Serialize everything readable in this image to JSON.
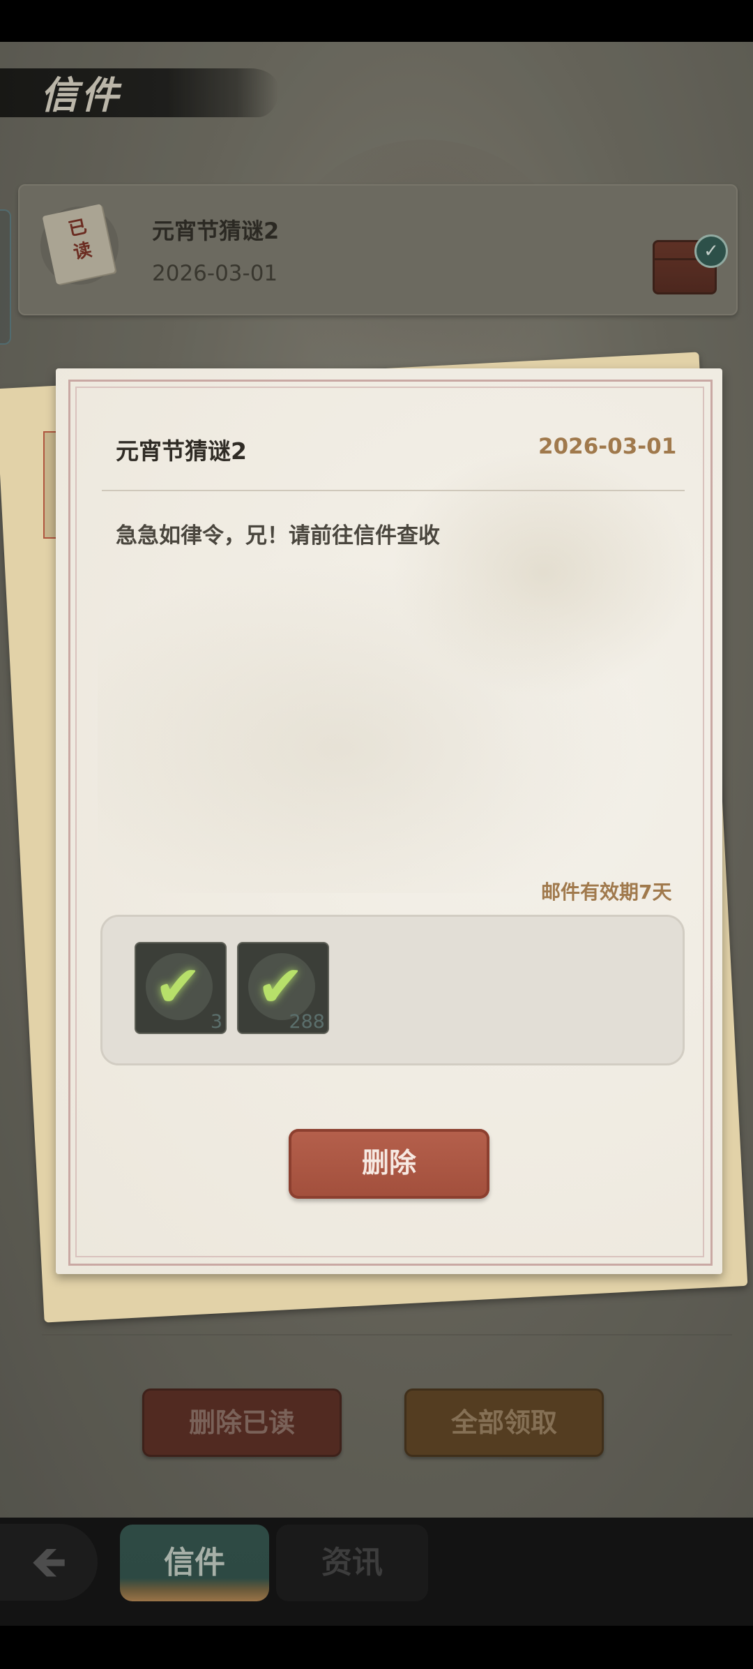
{
  "screen_title": "信件",
  "mail_list": [
    {
      "status_stamp": "已读",
      "title": "元宵节猜谜2",
      "date": "2026-03-01",
      "attachment_claimed": true
    }
  ],
  "letter": {
    "title": "元宵节猜谜2",
    "date": "2026-03-01",
    "body": "急急如律令，兄！请前往信件查收",
    "expiry_note": "邮件有效期7天",
    "rewards": [
      {
        "icon": "item-pouch-icon",
        "count": "3",
        "claimed": true
      },
      {
        "icon": "item-fish-icon",
        "count": "288",
        "claimed": true
      }
    ],
    "delete_label": "删除"
  },
  "actions": {
    "delete_read_label": "删除已读",
    "collect_all_label": "全部领取"
  },
  "nav": {
    "back_icon": "arrow-left-icon",
    "tabs": [
      {
        "label": "信件",
        "active": true
      },
      {
        "label": "资讯",
        "active": false
      }
    ]
  },
  "colors": {
    "accent_gold": "#a0794c",
    "delete_red": "#a24f3c",
    "claimed_check": "#b7e06a"
  }
}
